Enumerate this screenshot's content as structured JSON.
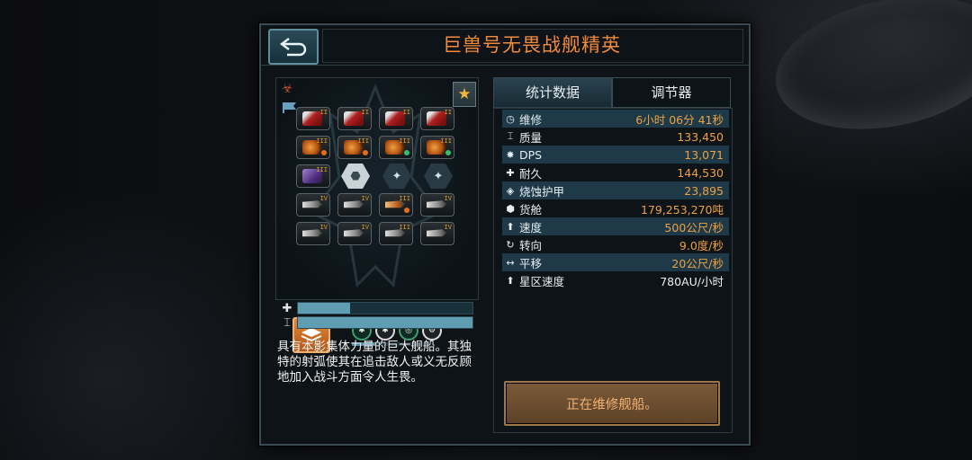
{
  "title": "巨兽号无畏战舰精英",
  "tabs": [
    "统计数据",
    "调节器"
  ],
  "stats": [
    {
      "icon": "clock-icon",
      "glyph": "◷",
      "label": "维修",
      "value": "6小时 06分 41秒"
    },
    {
      "icon": "mass-icon",
      "glyph": "⌶",
      "label": "质量",
      "value": "133,450"
    },
    {
      "icon": "dps-icon",
      "glyph": "✸",
      "label": "DPS",
      "value": "13,071"
    },
    {
      "icon": "durability-icon",
      "glyph": "✚",
      "label": "耐久",
      "value": "144,530"
    },
    {
      "icon": "ablative-armor-icon",
      "glyph": "◈",
      "label": "烧蚀护甲",
      "value": "23,895"
    },
    {
      "icon": "cargo-icon",
      "glyph": "⬢",
      "label": "货舱",
      "value": "179,253,270吨"
    },
    {
      "icon": "speed-icon",
      "glyph": "⬆",
      "label": "速度",
      "value": "500公尺/秒"
    },
    {
      "icon": "turn-icon",
      "glyph": "↻",
      "label": "转向",
      "value": "9.0度/秒"
    },
    {
      "icon": "strafe-icon",
      "glyph": "↔",
      "label": "平移",
      "value": "20公尺/秒"
    },
    {
      "icon": "warp-speed-icon",
      "glyph": "⬆",
      "label": "星区速度",
      "value": "780AU/小时"
    }
  ],
  "description": "具有本影集体力量的巨大舰船。其独特的射弧使其在追击敌人或义无反顾地加入战斗方面令人生畏。",
  "repair_button": "正在维修舰船。",
  "ship_bars": [
    {
      "icon": "health-icon",
      "glyph": "✚",
      "fill_fraction": 0.3
    },
    {
      "icon": "mass-icon",
      "glyph": "⌶",
      "fill_fraction": 1.0
    }
  ],
  "slot_levels": [
    "II",
    "II",
    "II",
    "II",
    "III",
    "III",
    "III",
    "III",
    "III",
    "",
    "",
    "",
    "IV",
    "IV",
    "III",
    "IV",
    "IV",
    "IV",
    "III",
    "IV"
  ],
  "accent_colors": {
    "title": "#f28b3c",
    "value": "#f0a040",
    "panel_border": "#3a4a52",
    "row_alt": "#1e3a48"
  }
}
